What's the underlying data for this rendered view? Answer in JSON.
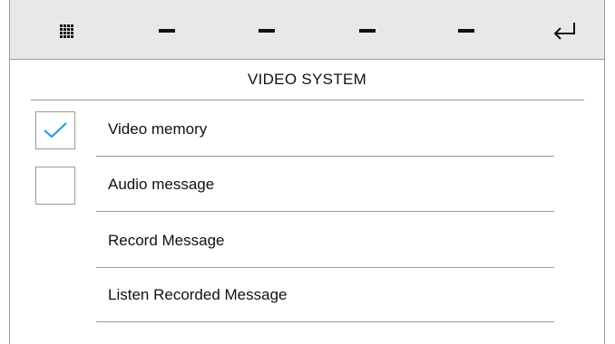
{
  "toolbar": {
    "buttons": [
      {
        "icon": "grid-icon"
      },
      {
        "icon": "dash-icon"
      },
      {
        "icon": "dash-icon"
      },
      {
        "icon": "dash-icon"
      },
      {
        "icon": "dash-icon"
      },
      {
        "icon": "return-arrow-icon"
      }
    ]
  },
  "title": "VIDEO SYSTEM",
  "items": [
    {
      "label": "Video memory",
      "has_checkbox": true,
      "checked": true
    },
    {
      "label": "Audio message",
      "has_checkbox": true,
      "checked": false
    },
    {
      "label": "Record Message",
      "has_checkbox": false
    },
    {
      "label": "Listen Recorded Message",
      "has_checkbox": false
    }
  ],
  "colors": {
    "toolbar_bg": "#e8e8e8",
    "check_accent": "#1e9ad6",
    "text": "#111111",
    "divider": "#9a9a9a"
  }
}
